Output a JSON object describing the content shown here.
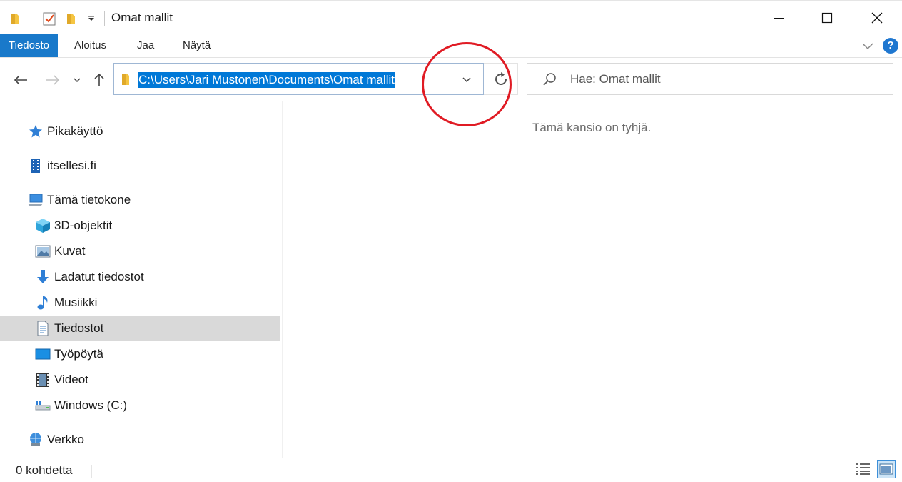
{
  "window": {
    "title": "Omat mallit",
    "controls": {
      "minimize": "minimize-icon",
      "maximize": "maximize-icon",
      "close": "close-icon"
    }
  },
  "quick_access_toolbar": [
    "folder-icon",
    "properties-icon",
    "new-folder-icon",
    "customize-dropdown-icon"
  ],
  "ribbon": {
    "tabs": [
      {
        "label": "Tiedosto",
        "active": true
      },
      {
        "label": "Aloitus"
      },
      {
        "label": "Jaa"
      },
      {
        "label": "Näytä"
      }
    ],
    "help": "?"
  },
  "navigation": {
    "address": "C:\\Users\\Jari Mustonen\\Documents\\Omat mallit",
    "search_placeholder": "Hae: Omat mallit"
  },
  "sidebar": {
    "items": [
      {
        "label": "Pikakäyttö",
        "icon": "star-icon"
      },
      {
        "label": "itsellesi.fi",
        "icon": "building-icon"
      },
      {
        "label": "Tämä tietokone",
        "icon": "computer-icon"
      },
      {
        "label": "3D-objektit",
        "icon": "cube-icon"
      },
      {
        "label": "Kuvat",
        "icon": "pictures-icon"
      },
      {
        "label": "Ladatut tiedostot",
        "icon": "download-icon"
      },
      {
        "label": "Musiikki",
        "icon": "music-icon"
      },
      {
        "label": "Tiedostot",
        "icon": "documents-icon",
        "selected": true
      },
      {
        "label": "Työpöytä",
        "icon": "desktop-icon"
      },
      {
        "label": "Videot",
        "icon": "video-icon"
      },
      {
        "label": "Windows (C:)",
        "icon": "drive-icon"
      },
      {
        "label": "Verkko",
        "icon": "network-icon"
      }
    ]
  },
  "content": {
    "empty_message": "Tämä kansio on tyhjä."
  },
  "status_bar": {
    "item_count": "0 kohdetta"
  },
  "colors": {
    "accent": "#1979ca",
    "selection": "#0078d7",
    "annotation": "#e01b24"
  }
}
